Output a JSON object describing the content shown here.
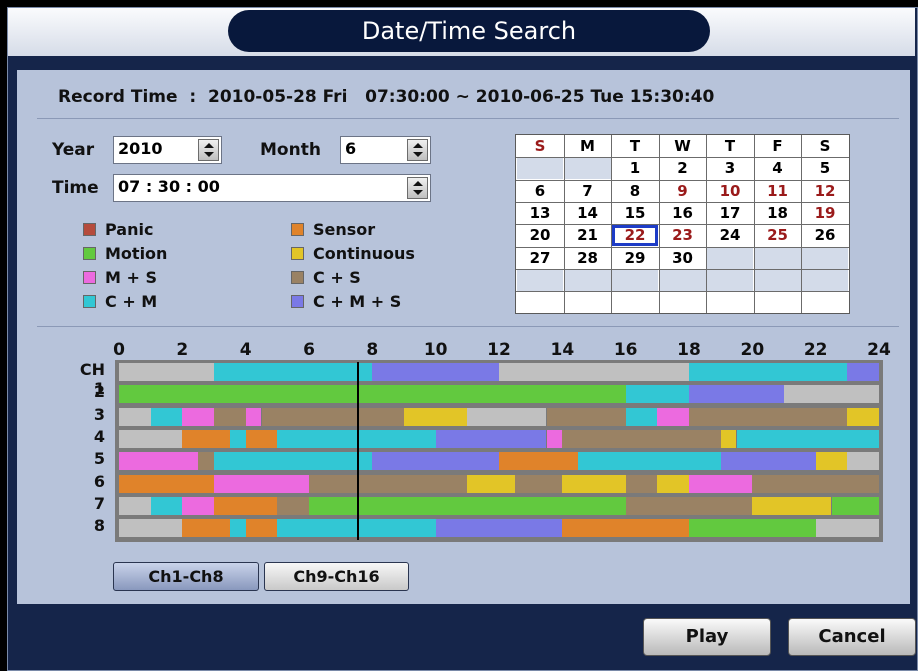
{
  "title": "Date/Time Search",
  "record_time": {
    "label": "Record Time",
    "value": ":  2010-05-28 Fri   07:30:00 ~ 2010-06-25 Tue 15:30:40"
  },
  "fields": {
    "year_label": "Year",
    "year_value": "2010",
    "month_label": "Month",
    "month_value": "6",
    "time_label": "Time",
    "time_value": "07 : 30 : 00"
  },
  "legend": [
    {
      "label": "Panic",
      "color": "#b54b3c"
    },
    {
      "label": "Sensor",
      "color": "#e0832a"
    },
    {
      "label": "Motion",
      "color": "#62c93f"
    },
    {
      "label": "Continuous",
      "color": "#e2c527"
    },
    {
      "label": "M + S",
      "color": "#ec6adf"
    },
    {
      "label": "C + S",
      "color": "#9a8264"
    },
    {
      "label": "C + M",
      "color": "#32c7d4"
    },
    {
      "label": "C + M + S",
      "color": "#7a79e6"
    }
  ],
  "calendar": {
    "weekdays": [
      "S",
      "M",
      "T",
      "W",
      "T",
      "F",
      "S"
    ],
    "weeks": [
      [
        "",
        "",
        "1",
        "2",
        "3",
        "4",
        "5"
      ],
      [
        "6",
        "7",
        "8",
        "9",
        "10",
        "11",
        "12"
      ],
      [
        "13",
        "14",
        "15",
        "16",
        "17",
        "18",
        "19"
      ],
      [
        "20",
        "21",
        "22",
        "23",
        "24",
        "25",
        "26"
      ],
      [
        "27",
        "28",
        "29",
        "30",
        "",
        "",
        ""
      ],
      [
        "",
        "",
        "",
        "",
        "",
        "",
        ""
      ]
    ],
    "record_days": [
      "9",
      "10",
      "11",
      "12",
      "19",
      "22",
      "23",
      "25"
    ],
    "selected_day": "22"
  },
  "timeline": {
    "hour_ticks": [
      "0",
      "2",
      "4",
      "6",
      "8",
      "10",
      "12",
      "14",
      "16",
      "18",
      "20",
      "22",
      "24"
    ],
    "cursor_hour": 7.5,
    "colors": {
      "none": "#c0c0c0",
      "motion": "#62c93f",
      "sensor": "#e0832a",
      "continuous": "#e2c527",
      "m_s": "#ec6adf",
      "c_s": "#9a8264",
      "c_m": "#32c7d4",
      "c_m_s": "#7a79e6"
    },
    "channels": [
      {
        "label": "CH 1",
        "segments": [
          [
            0,
            3,
            "none"
          ],
          [
            3,
            8,
            "c_m"
          ],
          [
            8,
            12,
            "c_m_s"
          ],
          [
            12,
            18,
            "none"
          ],
          [
            18,
            23,
            "c_m"
          ],
          [
            23,
            24,
            "c_m_s"
          ]
        ]
      },
      {
        "label": "2",
        "segments": [
          [
            0,
            16,
            "motion"
          ],
          [
            16,
            18,
            "c_m"
          ],
          [
            18,
            21,
            "c_m_s"
          ],
          [
            21,
            24,
            "none"
          ]
        ]
      },
      {
        "label": "3",
        "segments": [
          [
            0,
            1,
            "none"
          ],
          [
            1,
            2,
            "c_m"
          ],
          [
            2,
            3,
            "m_s"
          ],
          [
            3,
            4,
            "c_s"
          ],
          [
            4,
            4.5,
            "m_s"
          ],
          [
            4.5,
            9,
            "c_s"
          ],
          [
            9,
            11,
            "continuous"
          ],
          [
            11,
            13.5,
            "none"
          ],
          [
            13.5,
            16,
            "c_s"
          ],
          [
            16,
            17,
            "c_m"
          ],
          [
            17,
            18,
            "m_s"
          ],
          [
            18,
            23,
            "c_s"
          ],
          [
            23,
            24,
            "continuous"
          ]
        ]
      },
      {
        "label": "4",
        "segments": [
          [
            0,
            2,
            "none"
          ],
          [
            2,
            3.5,
            "sensor"
          ],
          [
            3.5,
            4,
            "c_m"
          ],
          [
            4,
            5,
            "sensor"
          ],
          [
            5,
            10,
            "c_m"
          ],
          [
            10,
            13.5,
            "c_m_s"
          ],
          [
            13.5,
            14,
            "m_s"
          ],
          [
            14,
            19,
            "c_s"
          ],
          [
            19,
            19.5,
            "continuous"
          ],
          [
            19.5,
            24,
            "c_m"
          ]
        ]
      },
      {
        "label": "5",
        "segments": [
          [
            0,
            2.5,
            "m_s"
          ],
          [
            2.5,
            3,
            "c_s"
          ],
          [
            3,
            8,
            "c_m"
          ],
          [
            8,
            12,
            "c_m_s"
          ],
          [
            12,
            14.5,
            "sensor"
          ],
          [
            14.5,
            19,
            "c_m"
          ],
          [
            19,
            22,
            "c_m_s"
          ],
          [
            22,
            23,
            "continuous"
          ],
          [
            23,
            24,
            "none"
          ]
        ]
      },
      {
        "label": "6",
        "segments": [
          [
            0,
            3,
            "sensor"
          ],
          [
            3,
            6,
            "m_s"
          ],
          [
            6,
            11,
            "c_s"
          ],
          [
            11,
            12.5,
            "continuous"
          ],
          [
            12.5,
            14,
            "c_s"
          ],
          [
            14,
            16,
            "continuous"
          ],
          [
            16,
            17,
            "c_s"
          ],
          [
            17,
            18,
            "continuous"
          ],
          [
            18,
            20,
            "m_s"
          ],
          [
            20,
            24,
            "c_s"
          ]
        ]
      },
      {
        "label": "7",
        "segments": [
          [
            0,
            1,
            "none"
          ],
          [
            1,
            2,
            "c_m"
          ],
          [
            2,
            3,
            "m_s"
          ],
          [
            3,
            5,
            "sensor"
          ],
          [
            5,
            6,
            "c_s"
          ],
          [
            6,
            16,
            "motion"
          ],
          [
            16,
            20,
            "c_s"
          ],
          [
            20,
            22.5,
            "continuous"
          ],
          [
            22.5,
            24,
            "motion"
          ]
        ]
      },
      {
        "label": "8",
        "segments": [
          [
            0,
            2,
            "none"
          ],
          [
            2,
            3.5,
            "sensor"
          ],
          [
            3.5,
            4,
            "c_m"
          ],
          [
            4,
            5,
            "sensor"
          ],
          [
            5,
            10,
            "c_m"
          ],
          [
            10,
            14,
            "c_m_s"
          ],
          [
            14,
            18,
            "sensor"
          ],
          [
            18,
            22,
            "motion"
          ],
          [
            22,
            24,
            "none"
          ]
        ]
      }
    ]
  },
  "channel_buttons": {
    "ch1_8": "Ch1-Ch8",
    "ch9_16": "Ch9-Ch16"
  },
  "buttons": {
    "play": "Play",
    "cancel": "Cancel"
  }
}
